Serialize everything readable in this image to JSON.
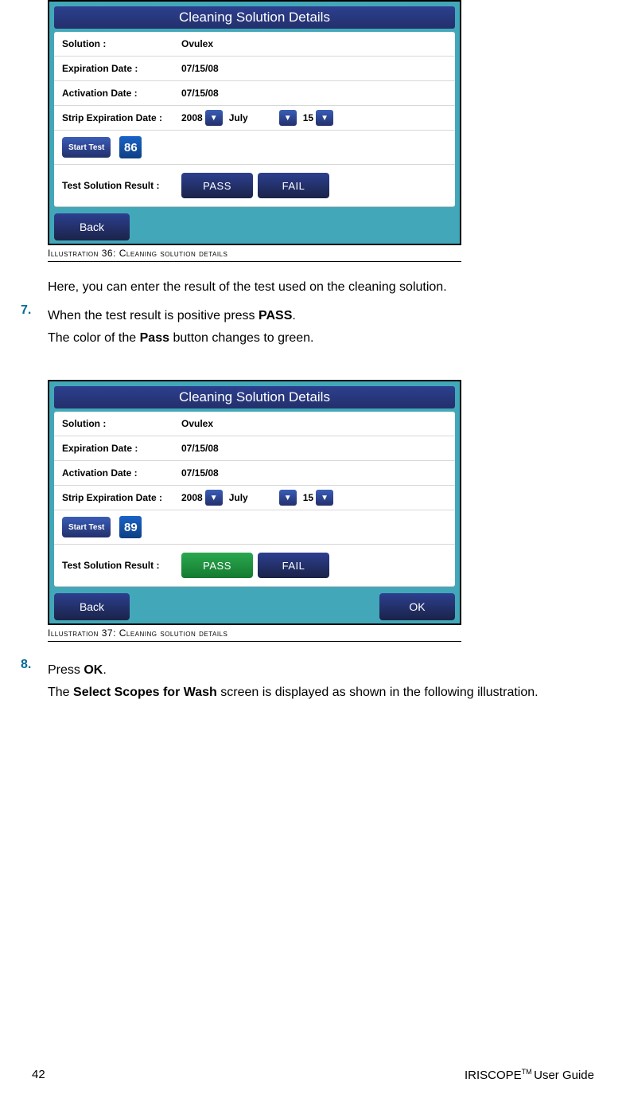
{
  "ill1": {
    "title": "Cleaning Solution Details",
    "solution_label": "Solution :",
    "solution_value": "Ovulex",
    "exp_label": "Expiration Date :",
    "exp_value": "07/15/08",
    "act_label": "Activation Date :",
    "act_value": "07/15/08",
    "strip_label": "Strip Expiration Date :",
    "strip_year": "2008",
    "strip_month": "July",
    "strip_day": "15",
    "start_test": "Start Test",
    "counter": "86",
    "result_label": "Test Solution Result :",
    "pass": "PASS",
    "fail": "FAIL",
    "back": "Back",
    "caption_prefix": "Illustration ",
    "caption_num": "36",
    "caption_text": ": Cleaning solution details"
  },
  "intro_text": "Here, you can enter the result of the test used on the cleaning solution.",
  "step7": {
    "num": "7.",
    "line1a": "When the test result is positive press ",
    "line1b": "PASS",
    "line1c": ".",
    "line2a": "The color of the ",
    "line2b": "Pass",
    "line2c": " button changes to green."
  },
  "ill2": {
    "title": "Cleaning Solution Details",
    "solution_label": "Solution :",
    "solution_value": "Ovulex",
    "exp_label": "Expiration Date :",
    "exp_value": "07/15/08",
    "act_label": "Activation Date :",
    "act_value": "07/15/08",
    "strip_label": "Strip Expiration Date :",
    "strip_year": "2008",
    "strip_month": "July",
    "strip_day": "15",
    "start_test": "Start Test",
    "counter": "89",
    "result_label": "Test Solution Result :",
    "pass": "PASS",
    "fail": "FAIL",
    "back": "Back",
    "ok": "OK",
    "caption_prefix": "Illustration ",
    "caption_num": "37",
    "caption_text": ": Cleaning solution details"
  },
  "step8": {
    "num": "8.",
    "line1a": "Press ",
    "line1b": "OK",
    "line1c": ".",
    "line2a": "The ",
    "line2b": "Select Scopes for Wash",
    "line2c": " screen is displayed as shown in the following illustration."
  },
  "footer": {
    "page": "42",
    "brand_a": "IRISCOPE",
    "brand_tm": "TM ",
    "brand_b": "User Guide"
  }
}
